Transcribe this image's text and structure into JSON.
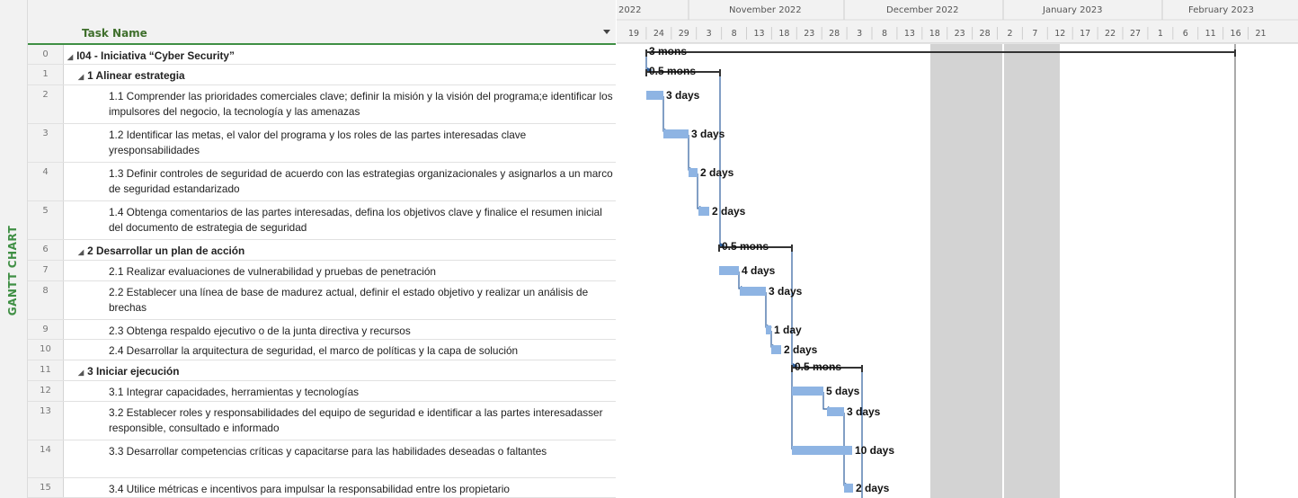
{
  "side_label": "GANTT CHART",
  "grid": {
    "column_header": "Task Name",
    "rows": [
      {
        "id": "0",
        "level": 0,
        "name": "I04 - Iniciativa “Cyber Security”",
        "summary": true
      },
      {
        "id": "1",
        "level": 1,
        "name": "1 Alinear estrategia",
        "summary": true
      },
      {
        "id": "2",
        "level": 2,
        "name": "1.1 Comprender las prioridades comerciales clave; definir la misión y la visión del programa;e identificar los impulsores del negocio, la tecnología y las amenazas"
      },
      {
        "id": "3",
        "level": 2,
        "name": "1.2 Identificar las metas, el valor del programa y los roles de las partes interesadas clave yresponsabilidades"
      },
      {
        "id": "4",
        "level": 2,
        "name": "1.3 Definir controles de seguridad de acuerdo con las estrategias organizacionales y asignarlos a un marco de seguridad estandarizado"
      },
      {
        "id": "5",
        "level": 2,
        "name": "1.4 Obtenga comentarios de las partes interesadas, defina los objetivos clave y finalice el resumen inicial del documento de estrategia de seguridad"
      },
      {
        "id": "6",
        "level": 1,
        "name": "2 Desarrollar un plan de acción",
        "summary": true
      },
      {
        "id": "7",
        "level": 2,
        "name": "2.1 Realizar evaluaciones de vulnerabilidad y pruebas de penetración"
      },
      {
        "id": "8",
        "level": 2,
        "name": "2.2 Establecer una línea de base de madurez actual, definir el estado objetivo y realizar un análisis de brechas"
      },
      {
        "id": "9",
        "level": 2,
        "name": "2.3 Obtenga respaldo ejecutivo o de la junta directiva y recursos"
      },
      {
        "id": "10",
        "level": 2,
        "name": "2.4 Desarrollar la arquitectura de seguridad, el marco de políticas y la capa de solución"
      },
      {
        "id": "11",
        "level": 1,
        "name": "3 Iniciar ejecución",
        "summary": true
      },
      {
        "id": "12",
        "level": 2,
        "name": "3.1 Integrar capacidades, herramientas y tecnologías"
      },
      {
        "id": "13",
        "level": 2,
        "name": "3.2 Establecer roles y responsabilidades del equipo de seguridad e identificar a las partes interesadasser responsible, consultado e informado"
      },
      {
        "id": "14",
        "level": 2,
        "name": "3.3 Desarrollar competencias críticas y capacitarse para las habilidades deseadas o faltantes"
      },
      {
        "id": "15",
        "level": 2,
        "name": "3.4 Utilice métricas e incentivos para impulsar la responsabilidad entre los propietario"
      }
    ]
  },
  "timescale": {
    "months": [
      "2022",
      "November 2022",
      "December 2022",
      "January 2023",
      "February 2023"
    ],
    "days": [
      "19",
      "24",
      "29",
      "3",
      "8",
      "13",
      "18",
      "23",
      "28",
      "3",
      "8",
      "13",
      "18",
      "23",
      "28",
      "2",
      "7",
      "12",
      "17",
      "22",
      "27",
      "1",
      "6",
      "11",
      "16",
      "21"
    ]
  },
  "bars": [
    {
      "row": 0,
      "type": "summary",
      "label": "3 mons"
    },
    {
      "row": 1,
      "type": "summary",
      "label": "0.5 mons"
    },
    {
      "row": 2,
      "type": "task",
      "label": "3 days"
    },
    {
      "row": 3,
      "type": "task",
      "label": "3 days"
    },
    {
      "row": 4,
      "type": "task",
      "label": "2 days"
    },
    {
      "row": 5,
      "type": "task",
      "label": "2 days"
    },
    {
      "row": 6,
      "type": "summary",
      "label": "0.5 mons"
    },
    {
      "row": 7,
      "type": "task",
      "label": "4 days"
    },
    {
      "row": 8,
      "type": "task",
      "label": "3 days"
    },
    {
      "row": 9,
      "type": "task",
      "label": "1 day"
    },
    {
      "row": 10,
      "type": "task",
      "label": "2 days"
    },
    {
      "row": 11,
      "type": "summary",
      "label": "0.5 mons"
    },
    {
      "row": 12,
      "type": "task",
      "label": "5 days"
    },
    {
      "row": 13,
      "type": "task",
      "label": "3 days"
    },
    {
      "row": 14,
      "type": "task",
      "label": "10 days"
    },
    {
      "row": 15,
      "type": "task",
      "label": "2 days"
    }
  ],
  "colors": {
    "task_bar": "#8eb4e3",
    "summary_bar": "#333333",
    "link": "#2e5f9e",
    "nonworking": "#d3d3d3",
    "header_green": "#3f8f44"
  }
}
